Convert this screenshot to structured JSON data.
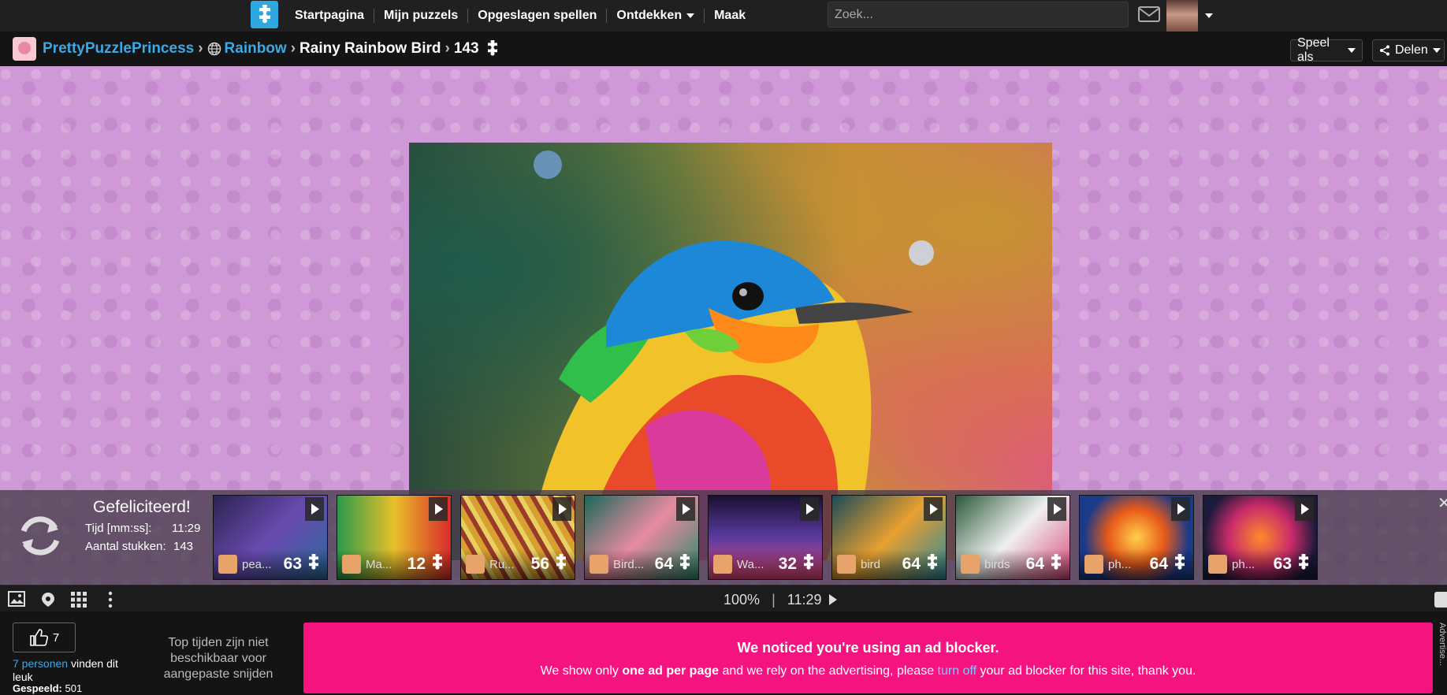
{
  "nav": {
    "items": [
      "Startpagina",
      "Mijn puzzels",
      "Opgeslagen spellen",
      "Ontdekken",
      "Maak"
    ],
    "search_placeholder": "Zoek..."
  },
  "breadcrumb": {
    "user": "PrettyPuzzlePrincess",
    "category": "Rainbow",
    "title": "Rainy Rainbow Bird",
    "pieces": "143",
    "play_as": "Speel als",
    "share": "Delen"
  },
  "completion": {
    "congrats": "Gefeliciteerd!",
    "time_label": "Tijd [mm:ss]:",
    "time_value": "11:29",
    "pieces_label": "Aantal stukken:",
    "pieces_value": "143"
  },
  "thumbnails": [
    {
      "name": "pea...",
      "count": "63"
    },
    {
      "name": "Ma...",
      "count": "12"
    },
    {
      "name": "Ru...",
      "count": "56"
    },
    {
      "name": "Bird...",
      "count": "64"
    },
    {
      "name": "Wa...",
      "count": "32"
    },
    {
      "name": "bird",
      "count": "64"
    },
    {
      "name": "birds",
      "count": "64"
    },
    {
      "name": "ph...",
      "count": "64"
    },
    {
      "name": "ph...",
      "count": "63"
    }
  ],
  "toolbar": {
    "zoom": "100%",
    "timer": "11:29"
  },
  "bottom": {
    "like_count": "7",
    "likes_link": "7 personen",
    "likes_rest": "vinden dit leuk",
    "played_label": "Gespeeld:",
    "played_value": "501",
    "toptimes": "Top tijden zijn niet beschikbaar voor aangepaste snijden",
    "ad_title": "We noticed you're using an ad blocker.",
    "ad_text_1": "We show only ",
    "ad_text_bold": "one ad per page",
    "ad_text_2": " and we rely on the advertising, please ",
    "ad_link": "turn off",
    "ad_text_3": " your ad blocker for this site, thank you.",
    "adv_label": "Advertise..."
  }
}
